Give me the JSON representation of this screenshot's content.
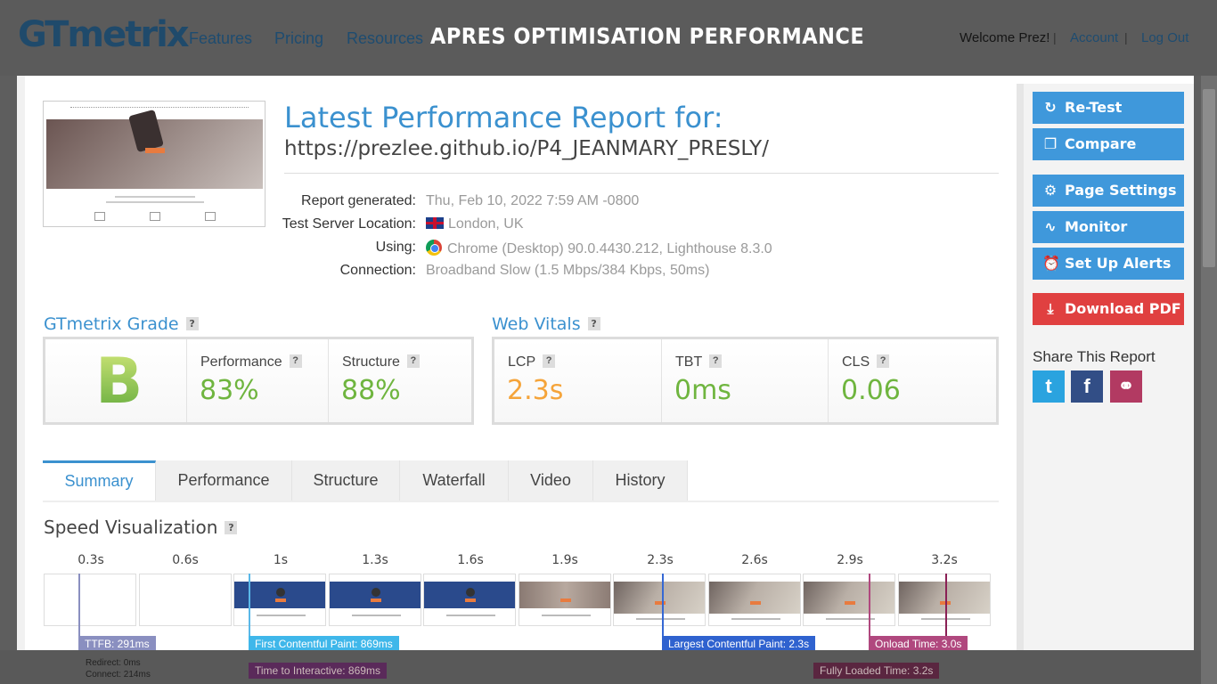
{
  "nav": {
    "logo": "GTmetrix",
    "links": [
      "Features",
      "Pricing",
      "Resources"
    ],
    "banner": "APRES OPTIMISATION PERFORMANCE",
    "welcome": "Welcome Prez!",
    "account": "Account",
    "logout": "Log Out",
    "separator": "|"
  },
  "report": {
    "title": "Latest Performance Report for:",
    "url": "https://prezlee.github.io/P4_JEANMARY_PRESLY/",
    "meta": [
      {
        "label": "Report generated:",
        "value": "Thu, Feb 10, 2022 7:59 AM -0800"
      },
      {
        "label": "Test Server Location:",
        "value": "London, UK"
      },
      {
        "label": "Using:",
        "value": "Chrome (Desktop) 90.0.4430.212, Lighthouse 8.3.0"
      },
      {
        "label": "Connection:",
        "value": "Broadband Slow (1.5 Mbps/384 Kbps, 50ms)"
      }
    ]
  },
  "grade": {
    "title": "GTmetrix Grade",
    "help": "?",
    "letter": "B",
    "performance_label": "Performance",
    "performance_value": "83%",
    "structure_label": "Structure",
    "structure_value": "88%"
  },
  "vitals": {
    "title": "Web Vitals",
    "lcp_label": "LCP",
    "lcp_value": "2.3s",
    "tbt_label": "TBT",
    "tbt_value": "0ms",
    "cls_label": "CLS",
    "cls_value": "0.06"
  },
  "colors": {
    "green": "#6fb53f",
    "orange": "#f5a43a",
    "blue": "#3b91cf",
    "red": "#e04040"
  },
  "tabs": [
    "Summary",
    "Performance",
    "Structure",
    "Waterfall",
    "Video",
    "History"
  ],
  "speed": {
    "title": "Speed Visualization",
    "times": [
      "0.3s",
      "0.6s",
      "1s",
      "1.3s",
      "1.6s",
      "1.9s",
      "2.3s",
      "2.6s",
      "2.9s",
      "3.2s"
    ],
    "markers": {
      "ttfb": "TTFB: 291ms",
      "fcp": "First Contentful Paint: 869ms",
      "lcp": "Largest Contentful Paint: 2.3s",
      "onload": "Onload Time: 3.0s",
      "tti": "Time to Interactive: 869ms",
      "fully_loaded": "Fully Loaded Time: 3.2s"
    },
    "ttfb_details": [
      "Redirect: 0ms",
      "Connect: 214ms"
    ]
  },
  "sidebar": {
    "retest": "Re-Test",
    "compare": "Compare",
    "page_settings": "Page Settings",
    "monitor": "Monitor",
    "alerts": "Set Up Alerts",
    "download_pdf": "Download PDF",
    "share_title": "Share This Report",
    "icons": [
      "refresh-icon",
      "compare-icon",
      "gear-icon",
      "pulse-icon",
      "alarm-clock-icon",
      "pdf-icon",
      "twitter-icon",
      "facebook-icon",
      "link-icon"
    ]
  }
}
